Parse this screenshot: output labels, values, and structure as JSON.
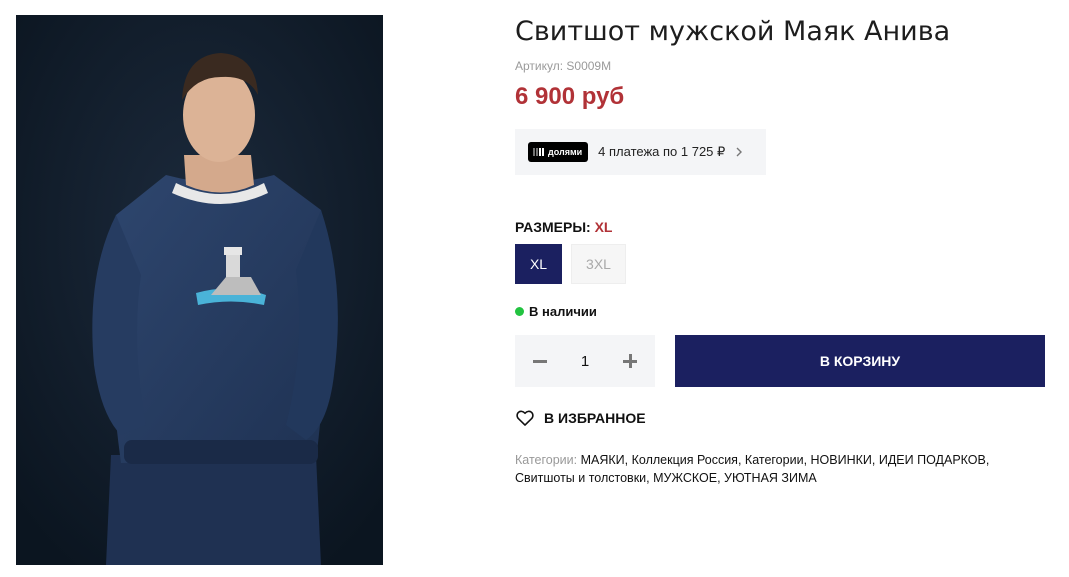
{
  "product": {
    "title": "Свитшот мужской Маяк Анива",
    "sku_label": "Артикул: S0009M",
    "price": "6 900 руб"
  },
  "dolyami": {
    "badge": "долями",
    "text": "4 платежа по 1 725 ₽"
  },
  "sizes": {
    "label": "РАЗМЕРЫ:",
    "selected": "XL",
    "options": [
      "XL",
      "3XL"
    ]
  },
  "stock": {
    "text": "В наличии",
    "color": "#22c340"
  },
  "quantity": {
    "value": "1"
  },
  "cart": {
    "label": "В КОРЗИНУ",
    "color": "#1b2060"
  },
  "favorite": {
    "label": "В ИЗБРАННОЕ",
    "icon": "heart-icon"
  },
  "categories": {
    "label": "Категории:",
    "items": [
      "МАЯКИ",
      "Коллекция Россия",
      "Категории",
      "НОВИНКИ",
      "ИДЕИ ПОДАРКОВ",
      "Свитшоты и толстовки",
      "МУЖСКОЕ",
      "УЮТНАЯ ЗИМА"
    ]
  },
  "colors": {
    "price": "#b13237",
    "accent": "#1b2060"
  }
}
